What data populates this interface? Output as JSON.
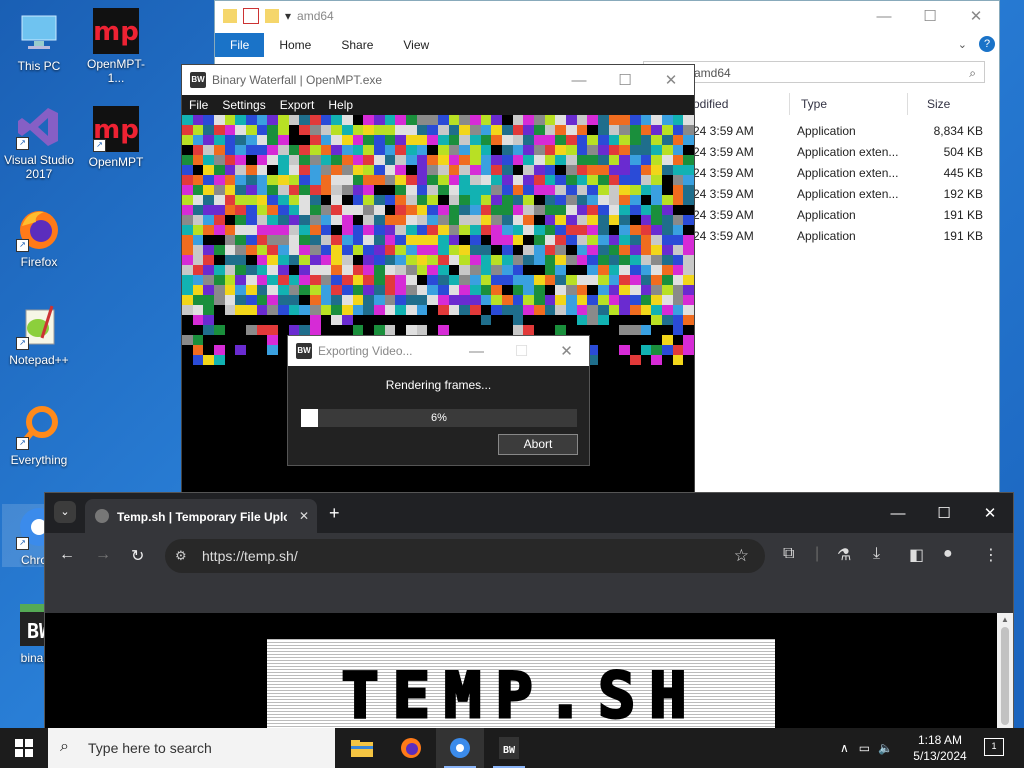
{
  "desktop": {
    "icons": [
      {
        "label": "This PC"
      },
      {
        "label": "OpenMPT-1..."
      },
      {
        "label": "Visual Studio 2017"
      },
      {
        "label": "OpenMPT"
      },
      {
        "label": "Firefox"
      },
      {
        "label": "Notepad++"
      },
      {
        "label": "Everything"
      },
      {
        "label": "Chrom"
      },
      {
        "label": "binary-"
      }
    ]
  },
  "explorer": {
    "title": "amd64",
    "ribbon_tabs": [
      "File",
      "Home",
      "Share",
      "View"
    ],
    "help_label": "?",
    "address": "amd64",
    "columns": {
      "modified": "odified",
      "type": "Type",
      "size": "Size"
    },
    "rows": [
      {
        "modified": "24 3:59 AM",
        "type": "Application",
        "size": "8,834 KB"
      },
      {
        "modified": "24 3:59 AM",
        "type": "Application exten...",
        "size": "504 KB"
      },
      {
        "modified": "24 3:59 AM",
        "type": "Application exten...",
        "size": "445 KB"
      },
      {
        "modified": "24 3:59 AM",
        "type": "Application exten...",
        "size": "192 KB"
      },
      {
        "modified": "24 3:59 AM",
        "type": "Application",
        "size": "191 KB"
      },
      {
        "modified": "24 3:59 AM",
        "type": "Application",
        "size": "191 KB"
      }
    ]
  },
  "binary_waterfall": {
    "title": "Binary Waterfall | OpenMPT.exe",
    "app_icon_text": "BW",
    "menu": [
      "File",
      "Settings",
      "Export",
      "Help"
    ],
    "mosaic_colors": [
      "#1a8f3c",
      "#2a4bd7",
      "#d62bd6",
      "#e0e0e0",
      "#c8c8c8",
      "#f06c1f",
      "#b8e024",
      "#12b2b2",
      "#6a2bd0",
      "#e23a3a",
      "#000000",
      "#1f6e8c",
      "#f2d61a",
      "#3aa0e0",
      "#8a8a8a"
    ]
  },
  "export_dialog": {
    "title": "Exporting Video...",
    "message": "Rendering frames...",
    "progress": 0.06,
    "progress_label": "6%",
    "abort_label": "Abort"
  },
  "chrome": {
    "tab_title": "Temp.sh | Temporary File Uplo...",
    "tab_close": "✕",
    "new_tab": "+",
    "url": "https://temp.sh/",
    "page_logo": "TEMP.SH"
  },
  "taskbar": {
    "search_placeholder": "Type here to search",
    "time": "1:18 AM",
    "date": "5/13/2024",
    "notification_count": "1"
  }
}
